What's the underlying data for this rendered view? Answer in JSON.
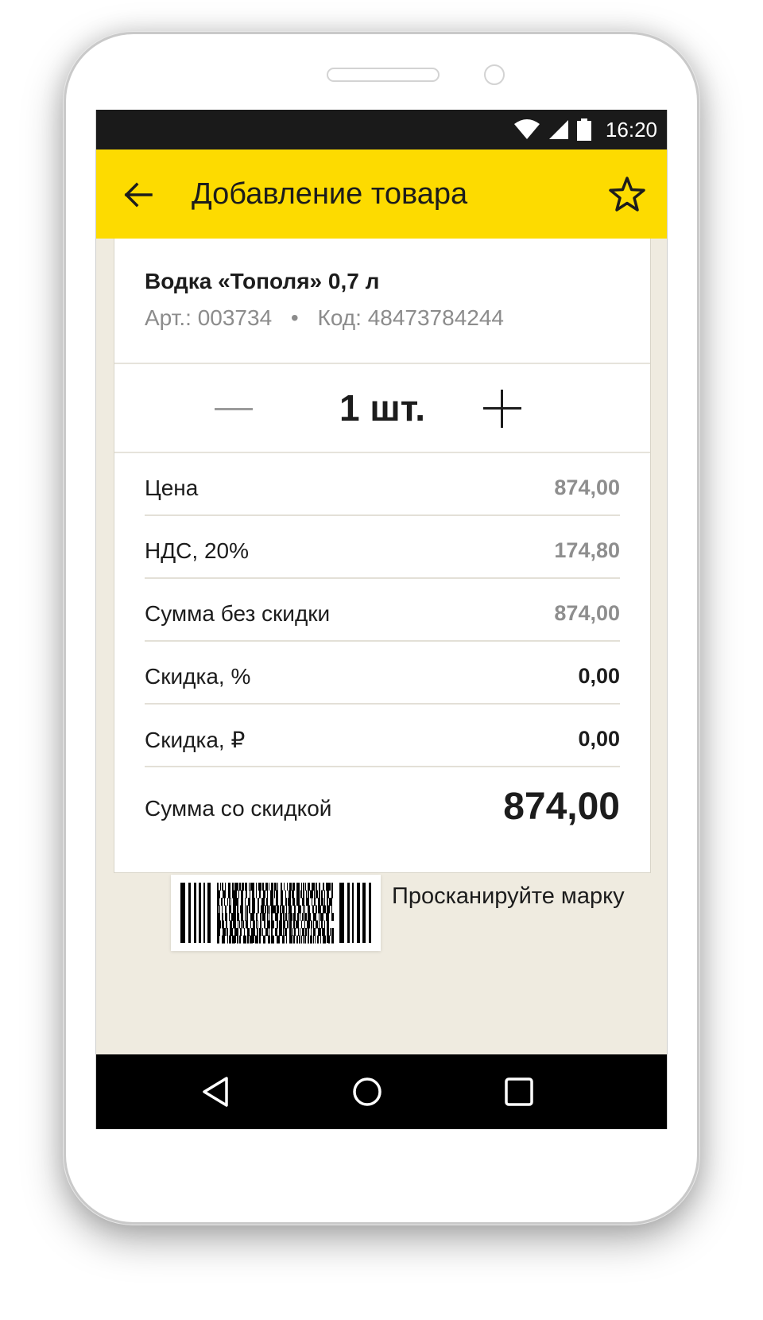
{
  "status_bar": {
    "time": "16:20",
    "icons": [
      "wifi-icon",
      "signal-icon",
      "battery-icon"
    ]
  },
  "app_bar": {
    "title": "Добавление товара",
    "back_icon": "arrow-left-icon",
    "favorite_icon": "star-outline-icon",
    "background_color": "#fddb00"
  },
  "product": {
    "name": "Водка «Тополя» 0,7 л",
    "article_label": "Арт.:",
    "article": "003734",
    "separator": "•",
    "code_label": "Код:",
    "code": "48473784244"
  },
  "quantity": {
    "value": "1 шт."
  },
  "rows": [
    {
      "label": "Цена",
      "value": "874,00",
      "style": "muted"
    },
    {
      "label": "НДС, 20%",
      "value": "174,80",
      "style": "muted"
    },
    {
      "label": "Сумма без скидки",
      "value": "874,00",
      "style": "muted"
    },
    {
      "label": "Скидка, %",
      "value": "0,00",
      "style": "dark"
    },
    {
      "label": "Скидка, ₽",
      "value": "0,00",
      "style": "dark"
    }
  ],
  "total": {
    "label": "Сумма со скидкой",
    "value": "874,00"
  },
  "scan": {
    "text": "Просканируйте марку",
    "icon": "datamatrix-barcode-icon"
  },
  "nav_bar": {
    "icons": [
      "nav-back-icon",
      "nav-home-icon",
      "nav-recents-icon"
    ]
  }
}
